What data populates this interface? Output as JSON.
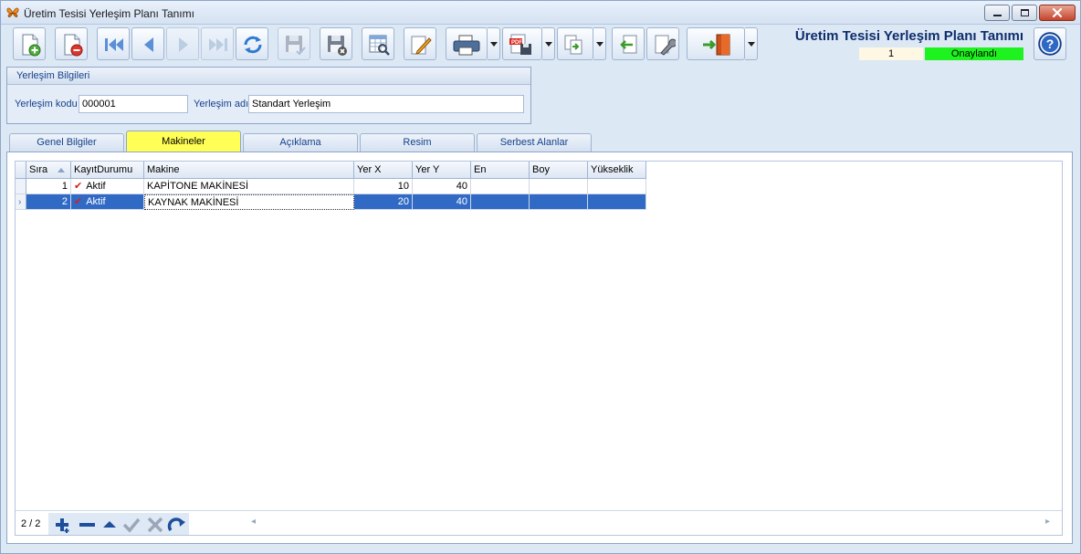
{
  "window": {
    "title": "Üretim Tesisi Yerleşim Planı Tanımı"
  },
  "toolbar": {
    "buttons": [
      {
        "name": "new-record",
        "icon": "document-add-icon"
      },
      {
        "name": "delete-record",
        "icon": "document-delete-icon"
      },
      {
        "name": "first-record",
        "icon": "skip-first-icon"
      },
      {
        "name": "previous-record",
        "icon": "arrow-left-icon"
      },
      {
        "name": "next-record",
        "icon": "arrow-right-icon"
      },
      {
        "name": "last-record",
        "icon": "skip-last-icon"
      },
      {
        "name": "refresh",
        "icon": "refresh-icon"
      },
      {
        "name": "save",
        "icon": "save-icon"
      },
      {
        "name": "save-cancel",
        "icon": "save-cancel-icon"
      },
      {
        "name": "preview",
        "icon": "preview-icon"
      },
      {
        "name": "edit",
        "icon": "edit-pencil-icon"
      },
      {
        "name": "print",
        "icon": "printer-icon"
      },
      {
        "name": "export-pdf",
        "icon": "pdf-save-icon"
      },
      {
        "name": "copy",
        "icon": "copy-document-icon"
      },
      {
        "name": "import",
        "icon": "import-arrow-icon"
      },
      {
        "name": "settings",
        "icon": "wrench-icon"
      },
      {
        "name": "exit",
        "icon": "exit-door-icon"
      }
    ]
  },
  "header": {
    "title": "Üretim Tesisi Yerleşim Planı Tanımı",
    "record_number": "1",
    "status": "Onaylandı",
    "status_color": "#1ff31f"
  },
  "group": {
    "title": "Yerleşim Bilgileri",
    "code_label": "Yerleşim kodu",
    "code_value": "000001",
    "name_label": "Yerleşim adı",
    "name_value": "Standart Yerleşim"
  },
  "tabs": [
    {
      "label": "Genel Bilgiler",
      "active": false
    },
    {
      "label": "Makineler",
      "active": true
    },
    {
      "label": "Açıklama",
      "active": false
    },
    {
      "label": "Resim",
      "active": false
    },
    {
      "label": "Serbest Alanlar",
      "active": false
    }
  ],
  "grid": {
    "columns": [
      "Sıra",
      "KayıtDurumu",
      "Makine",
      "Yer X",
      "Yer Y",
      "En",
      "Boy",
      "Yükseklik"
    ],
    "rows": [
      {
        "sira": "1",
        "durum": "Aktif",
        "makine": "KAPİTONE MAKİNESİ",
        "yer_x": "10",
        "yer_y": "40",
        "en": "",
        "boy": "",
        "yukseklik": ""
      },
      {
        "sira": "2",
        "durum": "Aktif",
        "makine": "KAYNAK MAKİNESİ",
        "yer_x": "20",
        "yer_y": "40",
        "en": "",
        "boy": "",
        "yukseklik": ""
      }
    ],
    "selected_row": 2
  },
  "navigator": {
    "count": "2 / 2"
  },
  "colors": {
    "active_tab": "#ffff55",
    "selection": "#316ac5",
    "title_blue": "#0d2d6b"
  }
}
